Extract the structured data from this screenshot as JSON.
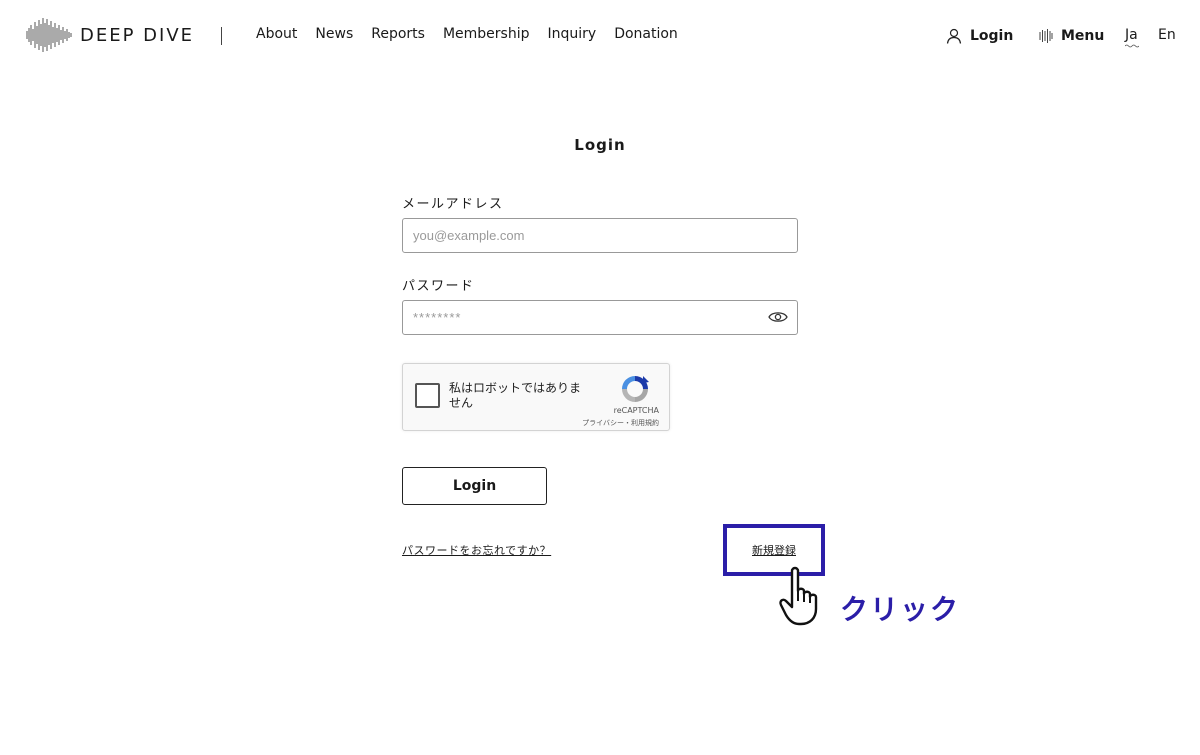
{
  "header": {
    "logo_text": "DEEP DIVE",
    "nav": [
      {
        "label": "About"
      },
      {
        "label": "News"
      },
      {
        "label": "Reports"
      },
      {
        "label": "Membership"
      },
      {
        "label": "Inquiry"
      },
      {
        "label": "Donation"
      }
    ],
    "login_label": "Login",
    "menu_label": "Menu",
    "lang_ja": "Ja",
    "lang_en": "En"
  },
  "form": {
    "title": "Login",
    "email_label": "メールアドレス",
    "email_placeholder": "you@example.com",
    "password_label": "パスワード",
    "password_placeholder": "********",
    "submit_label": "Login",
    "forgot_link": "パスワードをお忘れですか？",
    "register_link": "新規登録"
  },
  "recaptcha": {
    "label": "私はロボットではありません",
    "brand": "reCAPTCHA",
    "links": "プライバシー・利用規約"
  },
  "annotation": {
    "click_label": "クリック",
    "highlight_color": "#2b1ea8"
  }
}
